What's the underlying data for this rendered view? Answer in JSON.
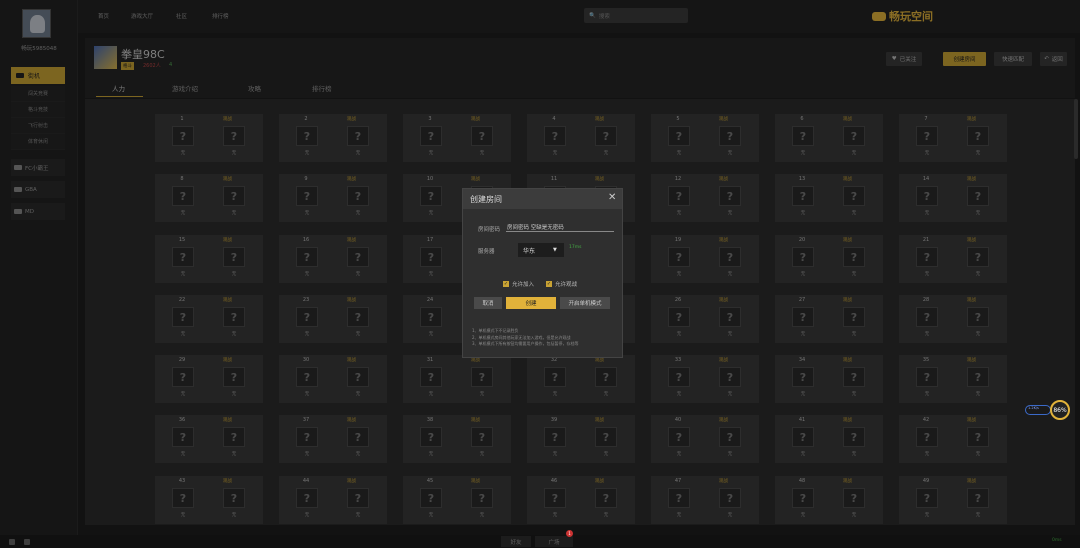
{
  "sidebar": {
    "user_name": "畅玩5985048",
    "main": "街机",
    "sub": [
      "闯关竞赛",
      "格斗竞技",
      "飞行射击",
      "体育休闲"
    ],
    "items": [
      "FC小霸王",
      "GBA",
      "MD"
    ]
  },
  "topbar": {
    "links": [
      "首页",
      "游戏大厅",
      "社区",
      "排行榜"
    ],
    "search_placeholder": "搜索",
    "brand": "畅玩空间"
  },
  "game": {
    "title": "拳皇98C",
    "badge": "格斗",
    "stat_players": "2602人",
    "stat_signal": "4",
    "follow": "已关注",
    "create_room": "创建房间",
    "quick_match": "快速匹配",
    "back": "返回"
  },
  "tabs": [
    "人力",
    "游戏介绍",
    "攻略",
    "排行榜"
  ],
  "rooms": {
    "numbers": [
      1,
      2,
      3,
      4,
      5,
      6,
      7,
      8,
      9,
      10,
      11,
      12,
      13,
      14,
      15,
      16,
      17,
      18,
      19,
      20,
      21,
      22,
      23,
      24,
      25,
      26,
      27,
      28,
      29,
      30,
      31,
      32,
      33,
      34,
      35,
      36,
      37,
      38,
      39,
      40,
      41,
      42,
      43,
      44,
      45,
      46,
      47,
      48,
      49
    ],
    "watch_label": "观战",
    "seat_glyph": "?",
    "seat_label": "无"
  },
  "modal": {
    "title": "创建房间",
    "close": "✕",
    "pwd_label": "房间密码",
    "pwd_value": "房间密码 空缺是无密码",
    "server_label": "服务器",
    "server_value": "华东",
    "signal": "17ms",
    "allow_join": "允许加入",
    "allow_watch": "允许观战",
    "cancel": "取消",
    "confirm": "创建",
    "single": "开启单机模式",
    "notes": [
      "1、单机模式下不记录胜负",
      "2、单机模式房间其他玩家无法加入游戏，但是允许观战",
      "3、单机模式下所有按钮均需要用户操作，包括暂停，存档等"
    ]
  },
  "speed": {
    "value": "86%",
    "label": "1.2K/s"
  },
  "bottom": {
    "friends": "好友",
    "chat": "广场",
    "chat_badge": "1",
    "signal": "0ms"
  },
  "colors": {
    "accent": "#c9a334",
    "bg": "#1e1e1e",
    "panel": "#2c2c2c"
  }
}
